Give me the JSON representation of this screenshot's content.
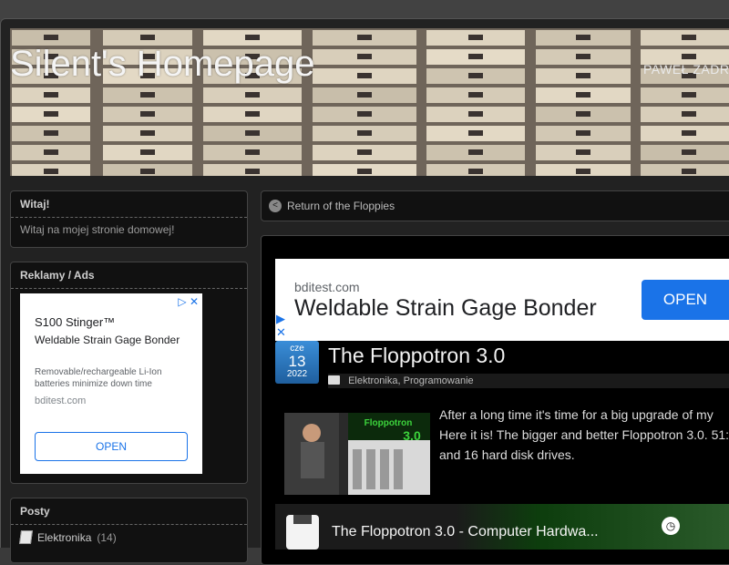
{
  "site": {
    "title": "Silent's Homepage",
    "description": "PAWEŁ ZADRO"
  },
  "sidebar": {
    "welcome": {
      "title": "Witaj!",
      "text": "Witaj na mojej stronie domowej!"
    },
    "ads": {
      "title": "Reklamy / Ads",
      "ad": {
        "brand": "S100 Stinger™",
        "headline": "Weldable Strain Gage Bonder",
        "body": "Removable/rechargeable Li-Ion batteries minimize down time",
        "domain": "bditest.com",
        "button": "OPEN"
      }
    },
    "posts": {
      "title": "Posty",
      "categories": [
        {
          "label": "Elektronika",
          "count": "(14)"
        }
      ]
    }
  },
  "breadcrumb": {
    "label": "Return of the Floppies"
  },
  "top_ad": {
    "domain": "bditest.com",
    "headline": "Weldable Strain Gage Bonder",
    "button": "OPEN"
  },
  "post": {
    "date": {
      "month": "cze",
      "day": "13",
      "year": "2022"
    },
    "title": "The Floppotron 3.0",
    "categories": [
      "Elektronika",
      "Programowanie"
    ],
    "separator": ", ",
    "text": "After a long time it's time for a big upgrade of my Here it is! The bigger and better Floppotron 3.0. 51: and 16 hard disk drives.",
    "thumbnail_text": "Floppotron 3.0"
  },
  "video": {
    "title": "The Floppotron 3.0 - Computer Hardwa..."
  }
}
